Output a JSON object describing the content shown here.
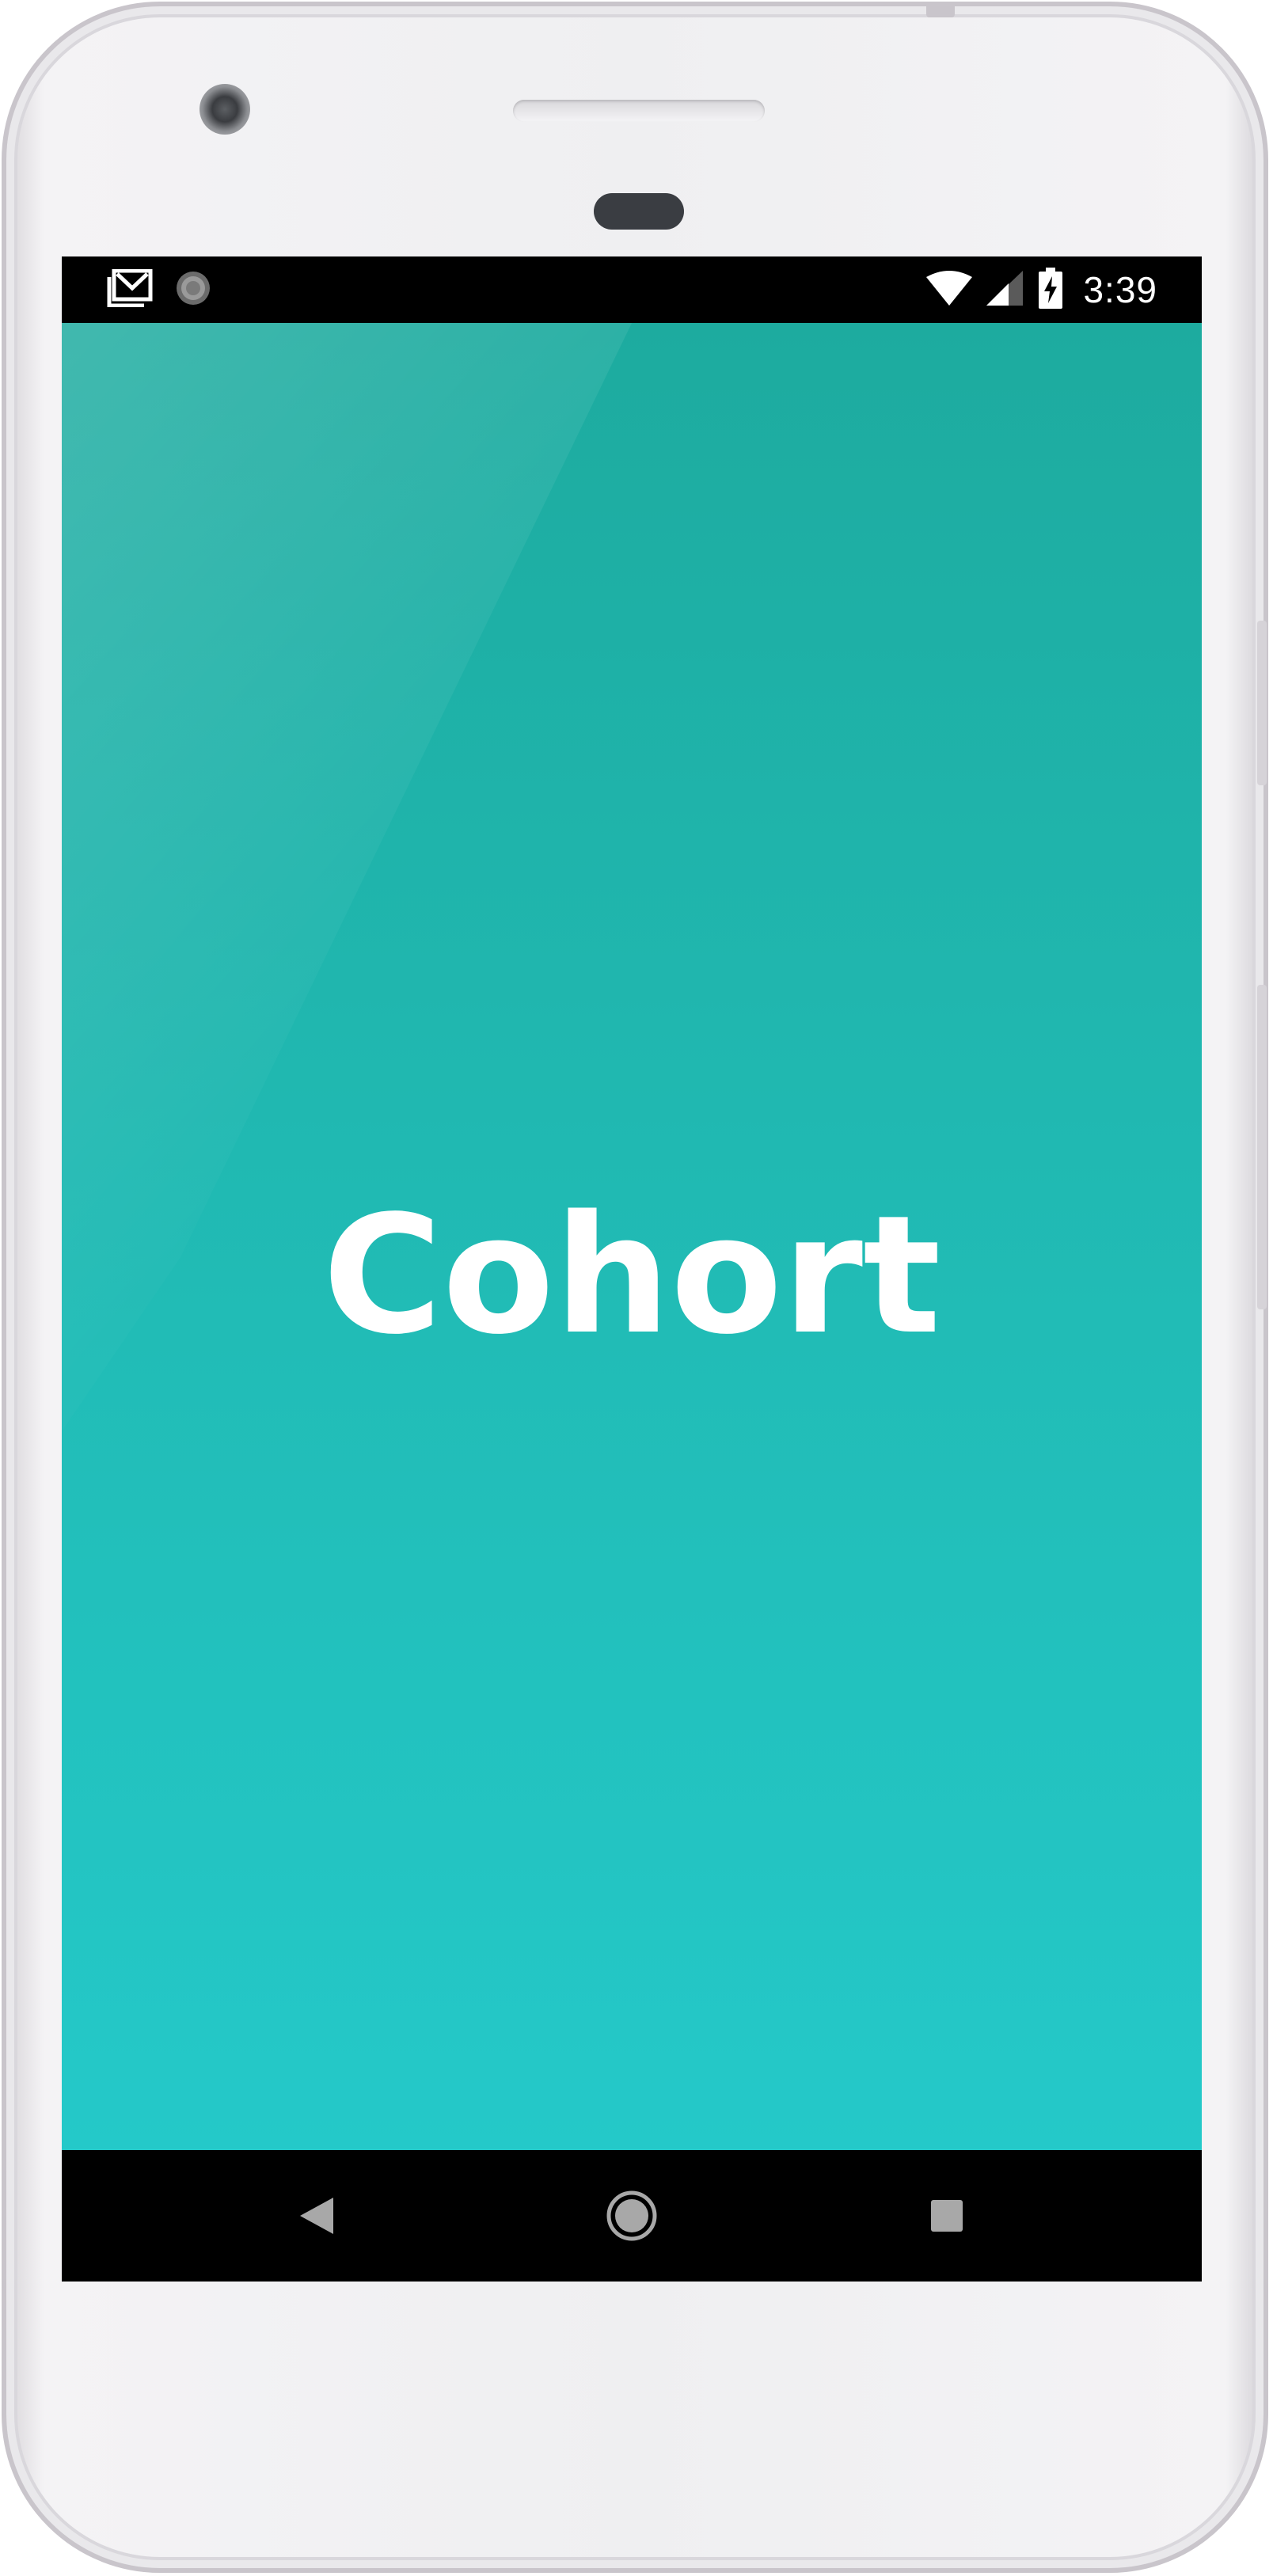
{
  "status_bar": {
    "time": "3:39",
    "notification_icons": [
      "gmail-icon",
      "sync-icon"
    ],
    "system_icons": [
      "wifi-icon",
      "cell-signal-icon",
      "battery-charging-icon"
    ]
  },
  "app": {
    "name": "Cohort",
    "background_top": "#1dab9f",
    "background_bottom": "#24c9c9",
    "text_color": "#ffffff"
  },
  "nav_bar": {
    "buttons": [
      "back-icon",
      "home-icon",
      "recents-icon"
    ]
  }
}
